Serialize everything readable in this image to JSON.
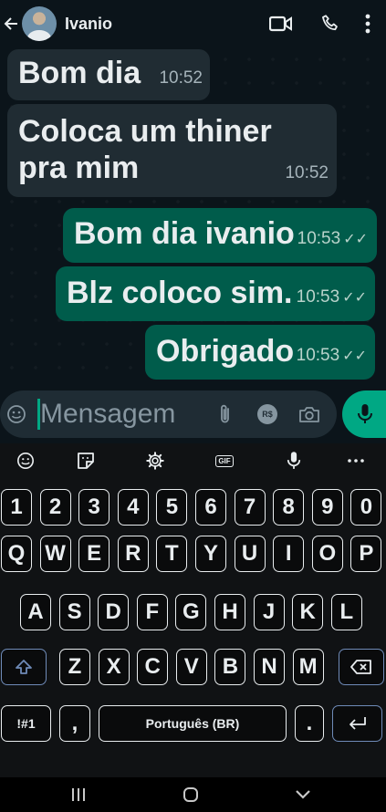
{
  "contact": {
    "name": "Ivanio",
    "avatar_icon": "contact-avatar"
  },
  "header_icons": [
    "back-arrow-icon",
    "video-call-icon",
    "phone-icon",
    "more-vert-icon"
  ],
  "messages": [
    {
      "direction": "incoming",
      "text": "Bom dia",
      "time": "10:52"
    },
    {
      "direction": "incoming",
      "text": "Coloca um thiner pra mim",
      "time": "10:52"
    },
    {
      "direction": "outgoing",
      "text": "Bom dia ivanio",
      "time": "10:53",
      "status": "read"
    },
    {
      "direction": "outgoing",
      "text": "Blz coloco sim.",
      "time": "10:53",
      "status": "read"
    },
    {
      "direction": "outgoing",
      "text": "Obrigado",
      "time": "10:53",
      "status": "read"
    }
  ],
  "composer": {
    "placeholder": "Mensagem",
    "value": "",
    "currency_label": "R$"
  },
  "keyboard": {
    "toolbar": [
      "emoji",
      "sticker",
      "settings",
      "gif",
      "voice",
      "more"
    ],
    "gif_label": "GIF",
    "row_numbers": [
      "1",
      "2",
      "3",
      "4",
      "5",
      "6",
      "7",
      "8",
      "9",
      "0"
    ],
    "row1": [
      "Q",
      "W",
      "E",
      "R",
      "T",
      "Y",
      "U",
      "I",
      "O",
      "P"
    ],
    "row2": [
      "A",
      "S",
      "D",
      "F",
      "G",
      "H",
      "J",
      "K",
      "L"
    ],
    "row3": [
      "Z",
      "X",
      "C",
      "V",
      "B",
      "N",
      "M"
    ],
    "symbols_label": "!#1",
    "comma": ",",
    "space_label": "Português (BR)",
    "period": "."
  },
  "colors": {
    "incoming": "#202c33",
    "outgoing": "#005c4b",
    "accent": "#00a884",
    "background": "#0b141a"
  }
}
